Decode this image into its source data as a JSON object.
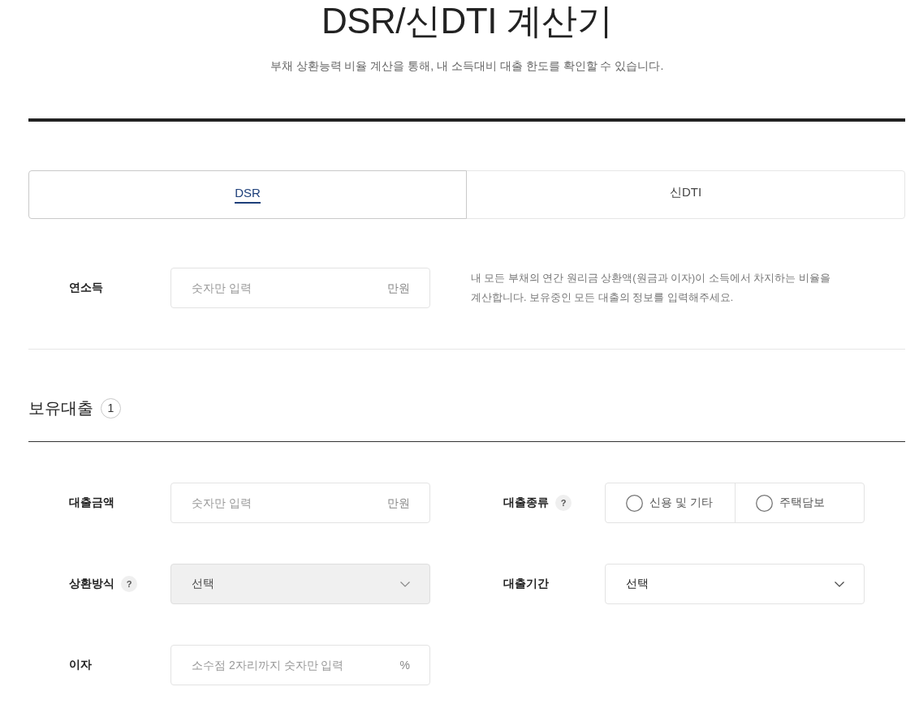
{
  "title": "DSR/신DTI 계산기",
  "subtitle": "부채 상환능력 비율 계산을 통해, 내 소득대비 대출 한도를 확인할 수 있습니다.",
  "tabs": [
    {
      "label": "DSR",
      "selected": true
    },
    {
      "label": "신DTI",
      "selected": false
    }
  ],
  "income": {
    "label": "연소득",
    "placeholder": "숫자만 입력",
    "unit": "만원",
    "description": "내 모든 부채의 연간 원리금 상환액(원금과 이자)이 소득에서 차지하는 비율을 계산합니다. 보유중인 모든 대출의 정보를 입력해주세요."
  },
  "loans_section": {
    "title": "보유대출",
    "count": "1"
  },
  "fields": [
    {
      "kind": "input",
      "label": "대출금액",
      "placeholder": "숫자만 입력",
      "unit": "만원"
    },
    {
      "kind": "radio",
      "label": "대출종류",
      "help": "?",
      "options": [
        {
          "label": "신용 및 기타",
          "selected": false
        },
        {
          "label": "주택담보",
          "selected": false
        }
      ]
    },
    {
      "kind": "select",
      "label": "상환방식",
      "help": "?",
      "value": "선택",
      "disabled": true
    },
    {
      "kind": "select",
      "label": "대출기간",
      "value": "선택",
      "disabled": false
    },
    {
      "kind": "input",
      "label": "이자",
      "placeholder": "소수점 2자리까지 숫자만 입력",
      "unit": "%"
    }
  ]
}
